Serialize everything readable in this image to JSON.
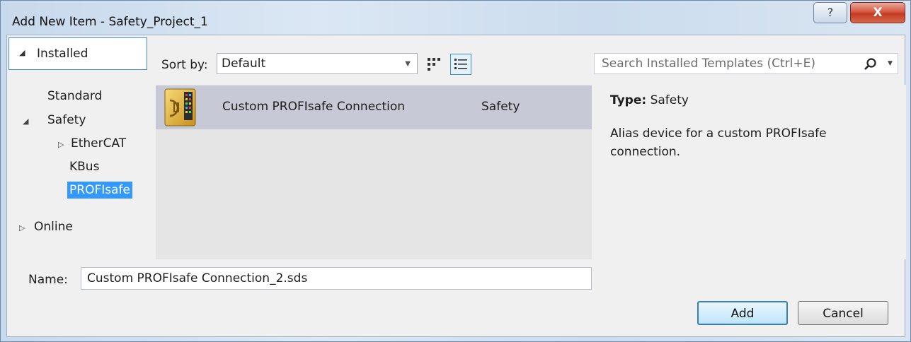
{
  "window": {
    "title": "Add New Item - Safety_Project_1",
    "help_label": "?",
    "close_label": "X"
  },
  "left_pane": {
    "header": "Installed",
    "tree": {
      "standard": "Standard",
      "safety": "Safety",
      "ethercat": "EtherCAT",
      "kbus": "KBus",
      "profisafe": "PROFIsafe",
      "online": "Online"
    }
  },
  "toolbar": {
    "sort_label": "Sort by:",
    "sort_value": "Default"
  },
  "search": {
    "placeholder": "Search Installed Templates (Ctrl+E)"
  },
  "items": [
    {
      "name": "Custom PROFIsafe Connection",
      "type": "Safety"
    }
  ],
  "details": {
    "type_label": "Type:",
    "type_value": "Safety",
    "description": "Alias device for a custom PROFIsafe connection."
  },
  "bottom": {
    "name_label": "Name:",
    "name_value": "Custom PROFIsafe Connection_2.sds",
    "add_label": "Add",
    "cancel_label": "Cancel"
  },
  "colors": {
    "selection": "#3399ff",
    "item_selected_bg": "#c8c9d6",
    "close_red": "#c23a22"
  }
}
